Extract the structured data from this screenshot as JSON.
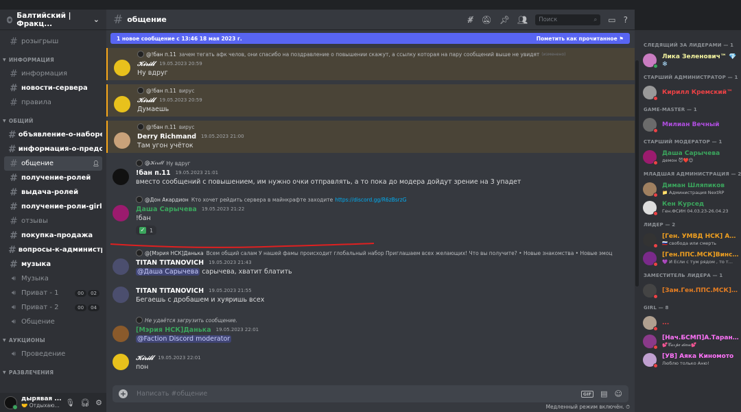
{
  "server": {
    "name": "Балтийский | Фракц..."
  },
  "channels": {
    "top": [
      {
        "label": "розыгрыш",
        "type": "text"
      }
    ],
    "cat_info": "ИНФОРМАЦИЯ",
    "info": [
      {
        "label": "информация",
        "type": "text"
      },
      {
        "label": "новости-сервера",
        "type": "text",
        "unread": true
      },
      {
        "label": "правила",
        "type": "text"
      }
    ],
    "cat_general": "ОБЩИЙ",
    "general": [
      {
        "label": "объявление-о-наборе...",
        "type": "text",
        "unread": true
      },
      {
        "label": "информация-о-предс...",
        "type": "text",
        "unread": true
      },
      {
        "label": "общение",
        "type": "text",
        "active": true
      },
      {
        "label": "получение-ролей",
        "type": "text",
        "unread": true
      },
      {
        "label": "выдача-ролей",
        "type": "text",
        "unread": true
      },
      {
        "label": "получение-роли-girl",
        "type": "text",
        "unread": true
      },
      {
        "label": "отзывы",
        "type": "text"
      },
      {
        "label": "покупка-продажа",
        "type": "text",
        "unread": true
      },
      {
        "label": "вопросы-к-администр...",
        "type": "text",
        "unread": true
      },
      {
        "label": "музыка",
        "type": "text",
        "unread": true
      },
      {
        "label": "Музыка",
        "type": "voice"
      },
      {
        "label": "Приват - 1",
        "type": "voice",
        "pills": [
          "00",
          "02"
        ]
      },
      {
        "label": "Приват - 2",
        "type": "voice",
        "pills": [
          "00",
          "04"
        ]
      },
      {
        "label": "Общение",
        "type": "voice"
      }
    ],
    "cat_auctions": "АУКЦИОНЫ",
    "auctions": [
      {
        "label": "Проведение",
        "type": "voice"
      }
    ],
    "cat_fun": "РАЗВЛЕЧЕНИЯ"
  },
  "user": {
    "name": "дырявая ...",
    "status": "🤝 Отдыхаю..."
  },
  "header": {
    "channel": "общение",
    "search_placeholder": "Поиск"
  },
  "newbar": {
    "text": "1 новое сообщение с 13:46 18 мая 2023 г.",
    "mark": "Пометить как прочитанное"
  },
  "messages": [
    {
      "hl": true,
      "reply_name": "@!бан п.11",
      "reply_text": "зачем тегать афк челов, они спасибо на поздравление о повышении скажут, а ссылку которая на пару сообщений выше не увидят",
      "reply_edited": "(изменено)",
      "author": "𝒦𝒾𝓇𝒾𝓁𝓁",
      "script": true,
      "color": "#ffffff",
      "time": "19.05.2023 20:59",
      "text": "Ну вдруг",
      "av": "#e8c11c"
    },
    {
      "hl": true,
      "reply_name": "@!бан п.11",
      "reply_text": "вирус",
      "author": "𝒦𝒾𝓇𝒾𝓁𝓁",
      "script": true,
      "color": "#ffffff",
      "time": "19.05.2023 20:59",
      "text": "Думаешь",
      "av": "#e8c11c"
    },
    {
      "hl": true,
      "reply_name": "@!бан п.11",
      "reply_text": "вирус",
      "author": "Derry Richmand",
      "color": "#ffffff",
      "time": "19.05.2023 21:00",
      "text": "Там угон учёток",
      "av": "#c9a27a"
    },
    {
      "reply_name": "@𝒦𝒾𝓇𝒾𝓁𝓁",
      "reply_text": "Ну вдруг",
      "author": "!бан п.11",
      "color": "#ffffff",
      "time": "19.05.2023 21:01",
      "text": "вместо сообщений с повышением, им нужно очки отправлять, а то пока до модера дойдут зрение на 3 упадет",
      "av": "#111111"
    },
    {
      "reply_name": "@Дон Акардион",
      "reply_text": "Кто хочет рейдить сервера в майнкрафте заходите",
      "reply_link": "https://discord.gg/R6zBsrzG",
      "author": "Даша Сарычева",
      "color": "#3ba55d",
      "time": "19.05.2023 21:22",
      "text": "!бан",
      "av": "#9b1b6e",
      "reaction": "1"
    },
    {
      "reply_name": "@[Мэрия НСК]Данька",
      "reply_text": "Всем общий салам У нашей фамы происходит глобальный набор Приглашаем всех желающих! Что вы получите? • Новые знакомства • Новые эмоц",
      "author": "TITAN TITANOVICH",
      "color": "#ffffff",
      "time": "19.05.2023 21:43",
      "mention": "@Даша Сарычева",
      "text": "сарычева, хватит блатить",
      "av": "#4b4e6e"
    },
    {
      "author": "TITAN TITANOVICH",
      "color": "#ffffff",
      "time": "19.05.2023 21:55",
      "text": "Бегаешь с дробашем и хуяришь всех",
      "av": "#4b4e6e"
    },
    {
      "reply_name": "",
      "reply_text": "Не удаётся загрузить сообщение.",
      "author": "[Мэрия НСК]Данька",
      "color": "#3ba55d",
      "time": "19.05.2023 22:01",
      "mention": "@Faction Discord moderator",
      "text": "",
      "av": "#8a5a2b"
    },
    {
      "author": "𝒦𝒾𝓇𝒾𝓁𝓁",
      "script": true,
      "color": "#ffffff",
      "time": "19.05.2023 22:01",
      "text": "пон",
      "av": "#e8c11c"
    }
  ],
  "input": {
    "placeholder": "Написать #общение"
  },
  "slowmode": "Медленный режим включён.",
  "members": [
    {
      "cat": "СЛЕДЯЩИЙ ЗА ЛИДЕРАМИ — 1",
      "list": [
        {
          "name": "Лика Зеленович™ 💎",
          "sub": "❄️",
          "color": "#f5f5a0",
          "av": "#c97cc1",
          "status": "#3ba55d"
        }
      ]
    },
    {
      "cat": "СТАРШИЙ АДМИНИСТРАТОР — 1",
      "list": [
        {
          "name": "Кирилл Кремский™",
          "sub": "",
          "color": "#ed4245",
          "av": "#999999",
          "status": "#ed4245"
        }
      ]
    },
    {
      "cat": "GAME-MASTER — 1",
      "list": [
        {
          "name": "Милиан Вечный",
          "sub": "",
          "color": "#b04ee0",
          "av": "#6b6b6b",
          "status": "#ed4245"
        }
      ]
    },
    {
      "cat": "СТАРШИЙ МОДЕРАТОР — 1",
      "list": [
        {
          "name": "Даша Сарычева",
          "sub": "демон 😈❤️😊",
          "color": "#3ba55d",
          "av": "#9b1b6e",
          "status": "#ed4245"
        }
      ]
    },
    {
      "cat": "МЛАДШАЯ АДМИНИСТРАЦИЯ — 2",
      "list": [
        {
          "name": "Диман Шляпиков",
          "sub": "📁 Администрация NextRP",
          "color": "#3ba55d",
          "av": "#a08060",
          "status": "#ed4245"
        },
        {
          "name": "Кен Курсед",
          "sub": "Ген.ФСИН 04.03.23-26.04.23",
          "color": "#3ba55d",
          "av": "#dddddd",
          "status": "#ed4245"
        }
      ]
    },
    {
      "cat": "ЛИДЕР — 2",
      "list": [
        {
          "name": "[Ген. УМВД НСК] Аль-...",
          "sub": "🇷🇺 свобода или смерть",
          "color": "#f0a020",
          "av": "#333333",
          "status": "#ed4245"
        },
        {
          "name": "[Ген.ППС.МСК]Винс ...",
          "sub": "💜 И Если с тум рядом , то т...",
          "color": "#f0a020",
          "av": "#7a2a8a",
          "status": "#ed4245"
        }
      ]
    },
    {
      "cat": "ЗАМЕСТИТЕЛЬ ЛИДЕРА — 1",
      "list": [
        {
          "name": "[Зам.Ген.ППС.МСК] Д...",
          "sub": "",
          "color": "#e67e22",
          "av": "#444444",
          "status": "#ed4245"
        }
      ]
    },
    {
      "cat": "GIRL — 8",
      "list": [
        {
          "name": "...",
          "sub": "",
          "color": "#ed4245",
          "av": "#b0a090",
          "status": "#ed4245"
        },
        {
          "name": "[Нач.БСМП]А.Таранова",
          "sub": "💕𝒞𝒶𝓇𝓅𝑒 𝒹𝒾𝑒𝓂💕",
          "color": "#ff73fa",
          "av": "#8a3a8a",
          "status": "#ed4245"
        },
        {
          "name": "[УВ] Аяка Киномото",
          "sub": "Люблю только Аню!",
          "color": "#ff73fa",
          "av": "#c0a0d0",
          "status": "#ed4245"
        }
      ]
    }
  ]
}
